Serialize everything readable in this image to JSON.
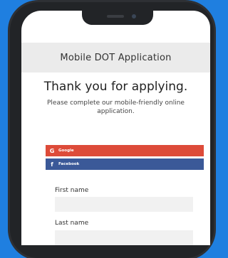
{
  "app": {
    "title": "Mobile DOT Application"
  },
  "content": {
    "heading": "Thank you for applying.",
    "subtext": "Please complete our mobile-friendly online application."
  },
  "social": {
    "google": {
      "icon": "G",
      "label": "Google",
      "color": "#dd4b39"
    },
    "facebook": {
      "icon": "f",
      "label": "Facebook",
      "color": "#3b5998"
    }
  },
  "form": {
    "first_name_label": "First name",
    "last_name_label": "Last name",
    "first_name_value": "",
    "last_name_value": ""
  },
  "colors": {
    "background": "#1f7fe0",
    "phone": "#222427",
    "header": "#ebebeb"
  }
}
